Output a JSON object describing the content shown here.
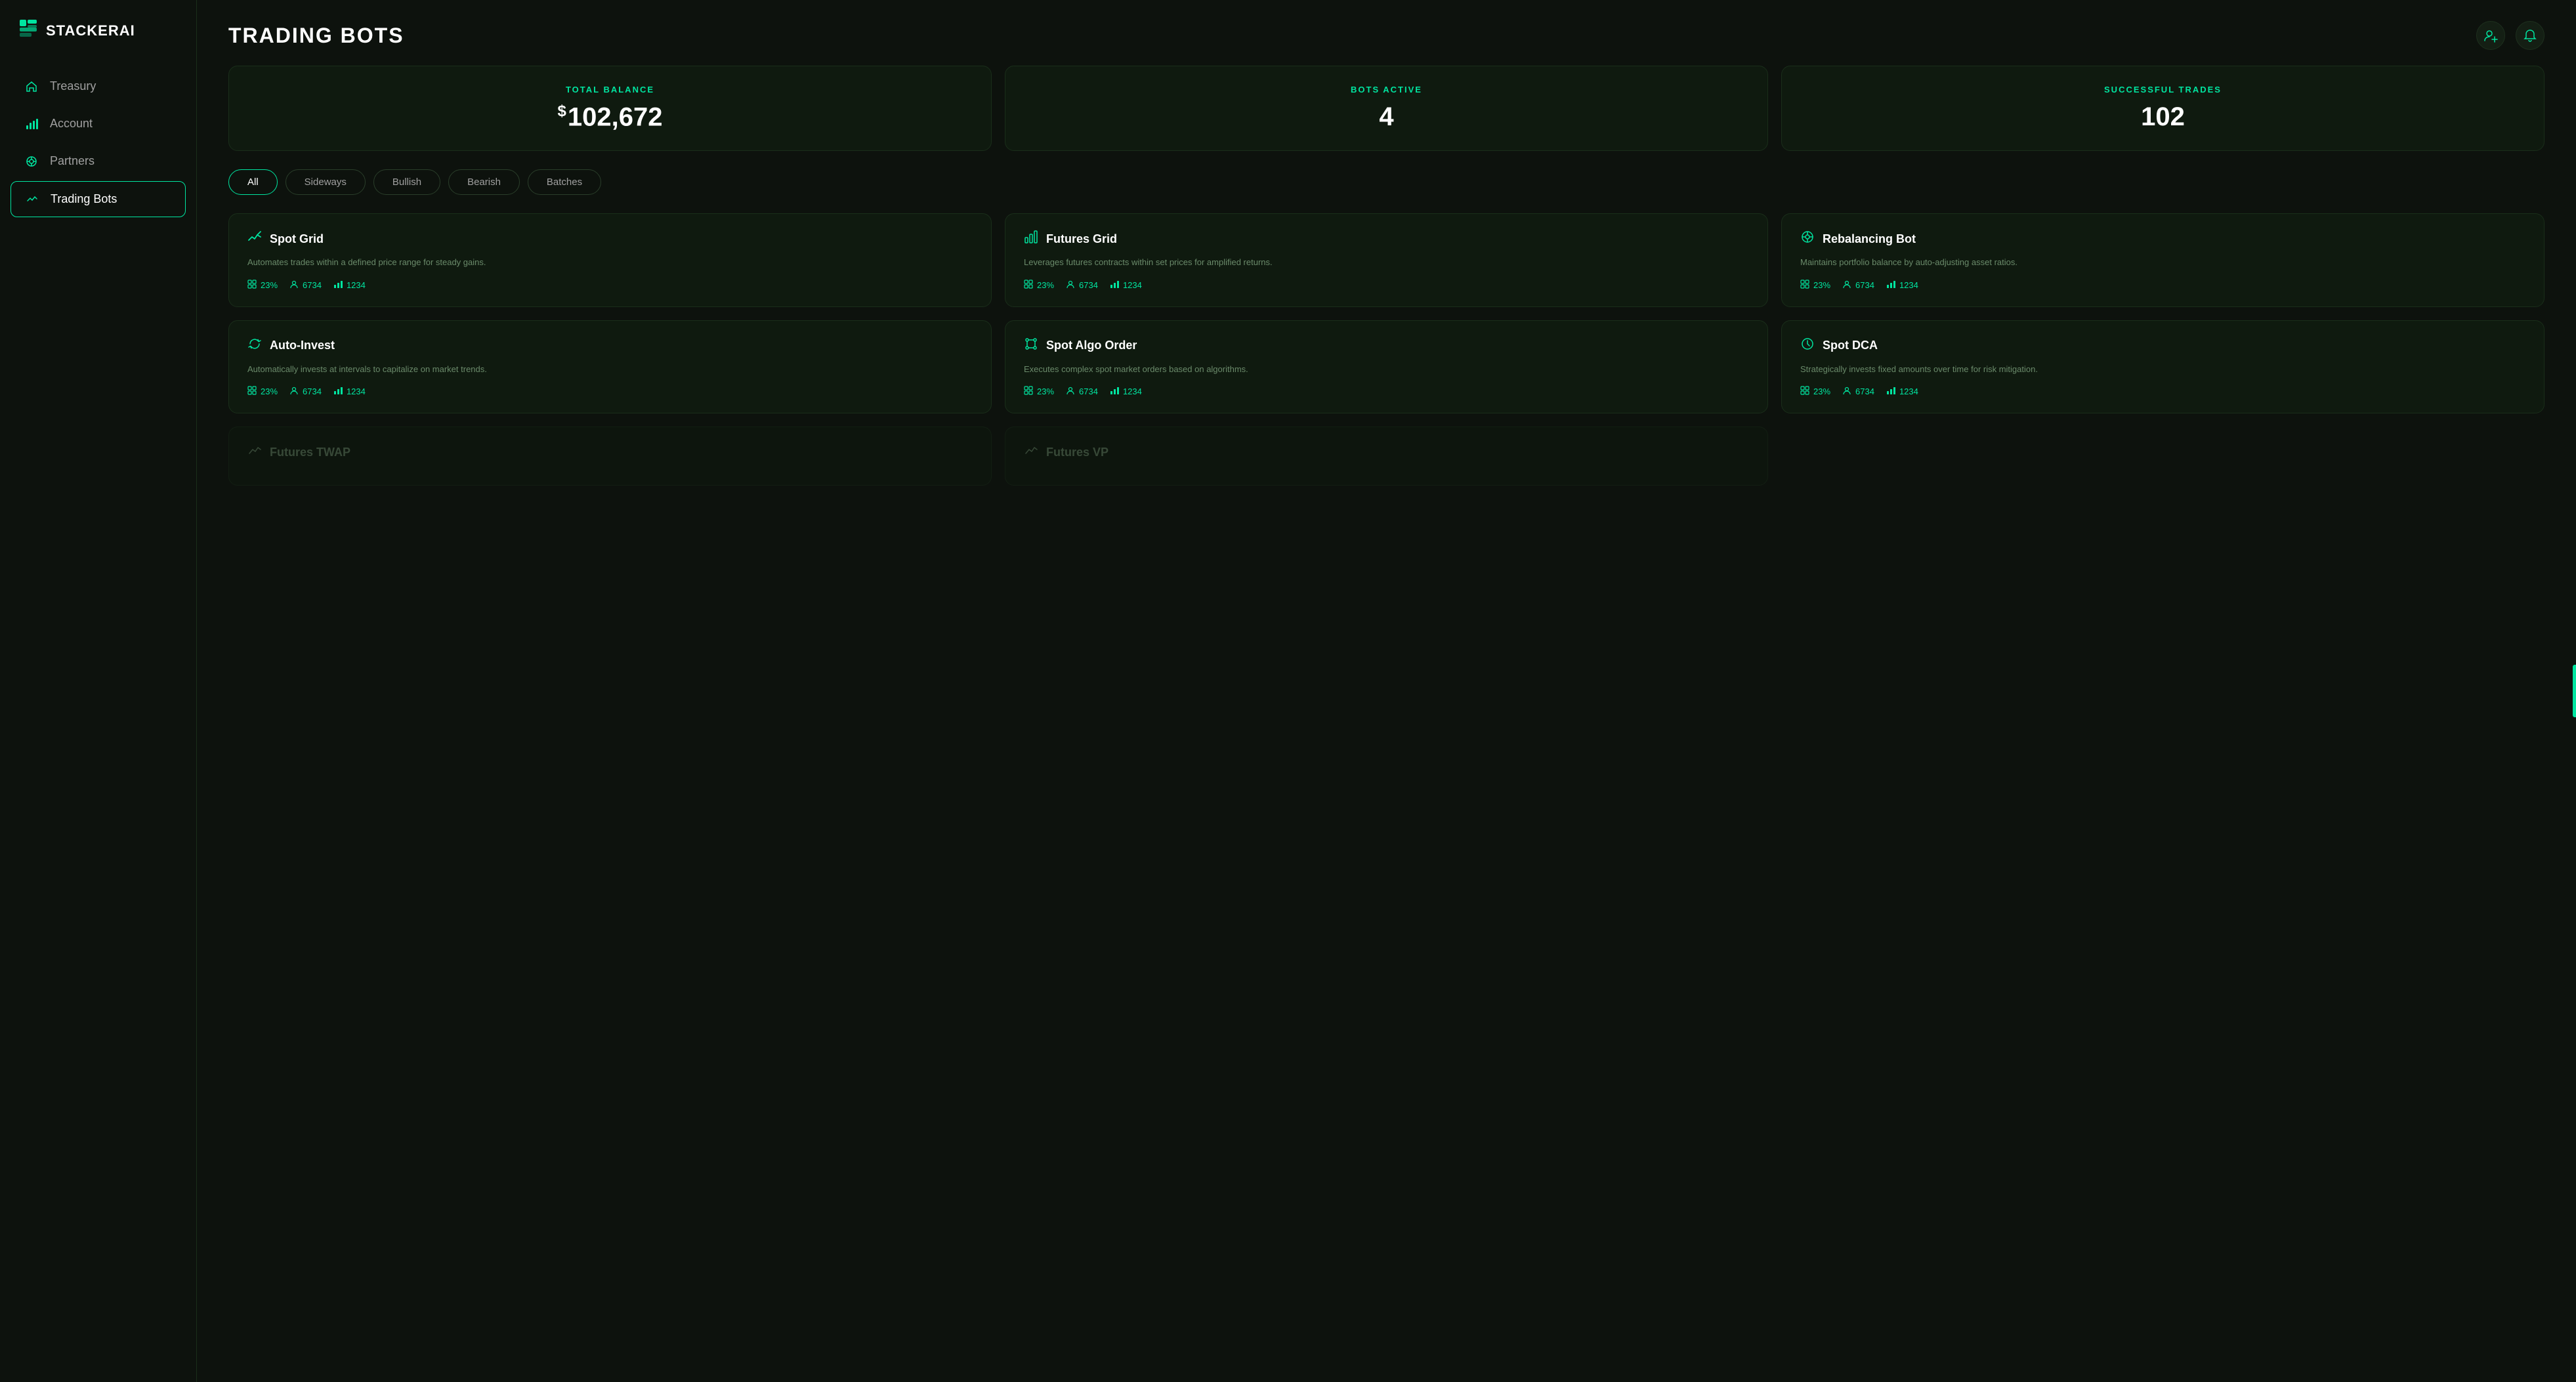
{
  "app": {
    "name": "STACKERAI"
  },
  "sidebar": {
    "nav_items": [
      {
        "id": "treasury",
        "label": "Treasury",
        "icon": "🏠",
        "active": false
      },
      {
        "id": "account",
        "label": "Account",
        "icon": "📊",
        "active": false
      },
      {
        "id": "partners",
        "label": "Partners",
        "icon": "🎯",
        "active": false
      },
      {
        "id": "trading-bots",
        "label": "Trading Bots",
        "icon": "📈",
        "active": true
      }
    ]
  },
  "header": {
    "title": "TRADING BOTS",
    "add_user_label": "Add User",
    "notification_label": "Notifications"
  },
  "stats": [
    {
      "id": "total-balance",
      "label": "TOTAL BALANCE",
      "value": "102,672",
      "prefix": "$"
    },
    {
      "id": "bots-active",
      "label": "BOTS ACTIVE",
      "value": "4",
      "prefix": ""
    },
    {
      "id": "successful-trades",
      "label": "SUCCESSFUL TRADES",
      "value": "102",
      "prefix": ""
    }
  ],
  "filters": [
    {
      "id": "all",
      "label": "All",
      "active": true
    },
    {
      "id": "sideways",
      "label": "Sideways",
      "active": false
    },
    {
      "id": "bullish",
      "label": "Bullish",
      "active": false
    },
    {
      "id": "bearish",
      "label": "Bearish",
      "active": false
    },
    {
      "id": "batches",
      "label": "Batches",
      "active": false
    }
  ],
  "bots": [
    {
      "id": "spot-grid",
      "name": "Spot Grid",
      "icon": "📈",
      "description": "Automates trades within a defined price range for steady gains.",
      "stat1": "23%",
      "stat2": "6734",
      "stat3": "1234",
      "partial": false
    },
    {
      "id": "futures-grid",
      "name": "Futures Grid",
      "icon": "📊",
      "description": "Leverages futures contracts within set prices for amplified returns.",
      "stat1": "23%",
      "stat2": "6734",
      "stat3": "1234",
      "partial": false
    },
    {
      "id": "rebalancing-bot",
      "name": "Rebalancing Bot",
      "icon": "⚖️",
      "description": "Maintains portfolio balance by auto-adjusting asset ratios.",
      "stat1": "23%",
      "stat2": "6734",
      "stat3": "1234",
      "partial": false
    },
    {
      "id": "auto-invest",
      "name": "Auto-Invest",
      "icon": "🔄",
      "description": "Automatically invests at intervals to capitalize on market trends.",
      "stat1": "23%",
      "stat2": "6734",
      "stat3": "1234",
      "partial": false
    },
    {
      "id": "spot-algo-order",
      "name": "Spot Algo Order",
      "icon": "🔀",
      "description": "Executes complex spot market orders based on algorithms.",
      "stat1": "23%",
      "stat2": "6734",
      "stat3": "1234",
      "partial": false
    },
    {
      "id": "spot-dca",
      "name": "Spot DCA",
      "icon": "🕐",
      "description": "Strategically invests fixed amounts over time for risk mitigation.",
      "stat1": "23%",
      "stat2": "6734",
      "stat3": "1234",
      "partial": false
    },
    {
      "id": "futures-twap",
      "name": "Futures TWAP",
      "icon": "📉",
      "description": "",
      "stat1": "",
      "stat2": "",
      "stat3": "",
      "partial": true
    },
    {
      "id": "futures-vp",
      "name": "Futures VP",
      "icon": "📉",
      "description": "",
      "stat1": "",
      "stat2": "",
      "stat3": "",
      "partial": true
    }
  ],
  "colors": {
    "accent": "#00e5a0",
    "bg_dark": "#0a0f0a",
    "bg_card": "#0f1a0f",
    "text_muted": "#6a8a6a"
  }
}
